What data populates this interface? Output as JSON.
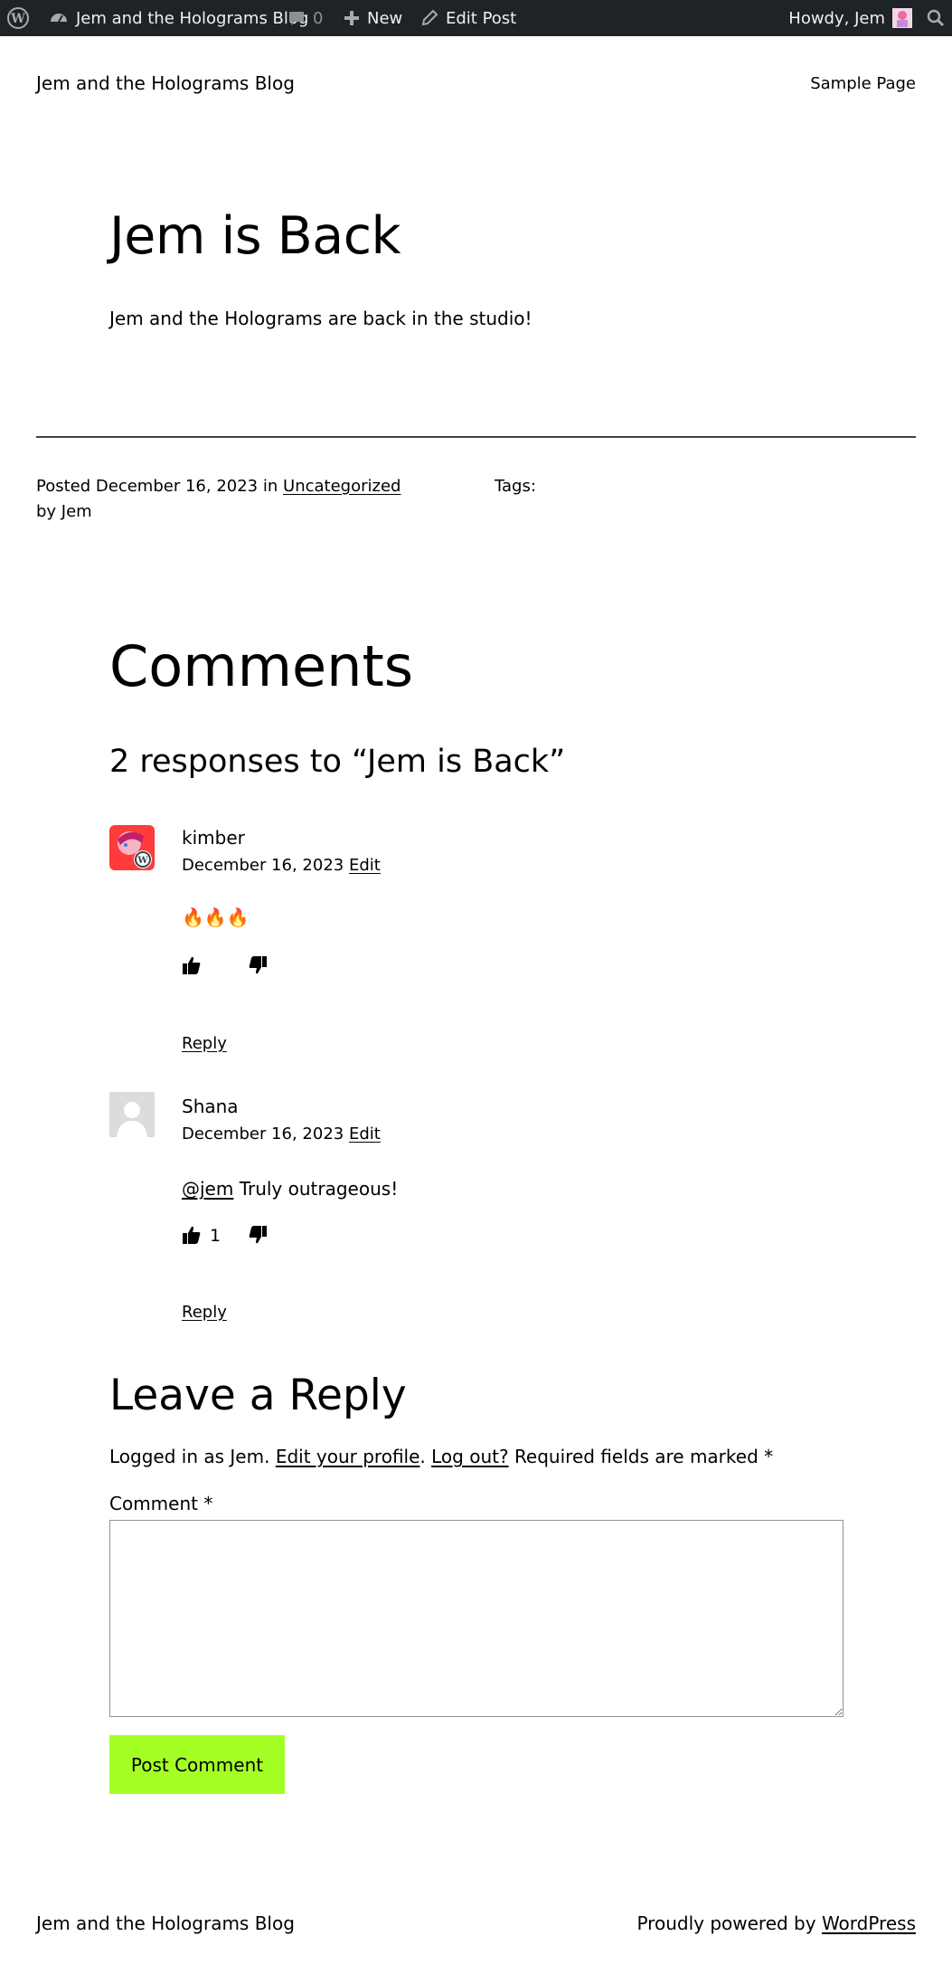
{
  "adminbar": {
    "site_name": "Jem and the Holograms Blog",
    "comments_count": "0",
    "new_label": "New",
    "edit_post_label": "Edit Post",
    "howdy_label": "Howdy, Jem",
    "bg_color": "#1d2327"
  },
  "header": {
    "site_title": "Jem and the Holograms Blog",
    "nav": {
      "sample_page": "Sample Page"
    }
  },
  "post": {
    "title": "Jem is Back",
    "excerpt": "Jem and the Holograms are back in the studio!",
    "meta": {
      "posted_prefix": "Posted",
      "date": "December 16, 2023",
      "in_word": "in",
      "category": "Uncategorized",
      "by_line": "by Jem",
      "tags_label": "Tags:"
    }
  },
  "comments": {
    "heading": "Comments",
    "responses_heading": "2 responses to “Jem is Back”",
    "list": [
      {
        "author": "kimber",
        "date": "December 16, 2023",
        "edit_label": "Edit",
        "body": "🔥🔥🔥",
        "likes": "",
        "reply_label": "Reply",
        "avatar_icon": "kimber-avatar-icon"
      },
      {
        "author": "Shana",
        "date": "December 16, 2023",
        "edit_label": "Edit",
        "mention": "@jem",
        "body": " Truly outrageous!",
        "likes": "1",
        "reply_label": "Reply",
        "avatar_icon": "default-avatar-icon"
      }
    ]
  },
  "reply_form": {
    "heading": "Leave a Reply",
    "logged_in_prefix": "Logged in as Jem.",
    "edit_profile": "Edit your profile",
    "log_out": "Log out?",
    "required_note": "Required fields are marked",
    "required_star": "*",
    "comment_label": "Comment",
    "comment_value": "",
    "submit_label": "Post Comment",
    "button_color": "#a3ff24"
  },
  "footer": {
    "site_title": "Jem and the Holograms Blog",
    "powered_prefix": "Proudly powered by",
    "powered_link": "WordPress"
  }
}
